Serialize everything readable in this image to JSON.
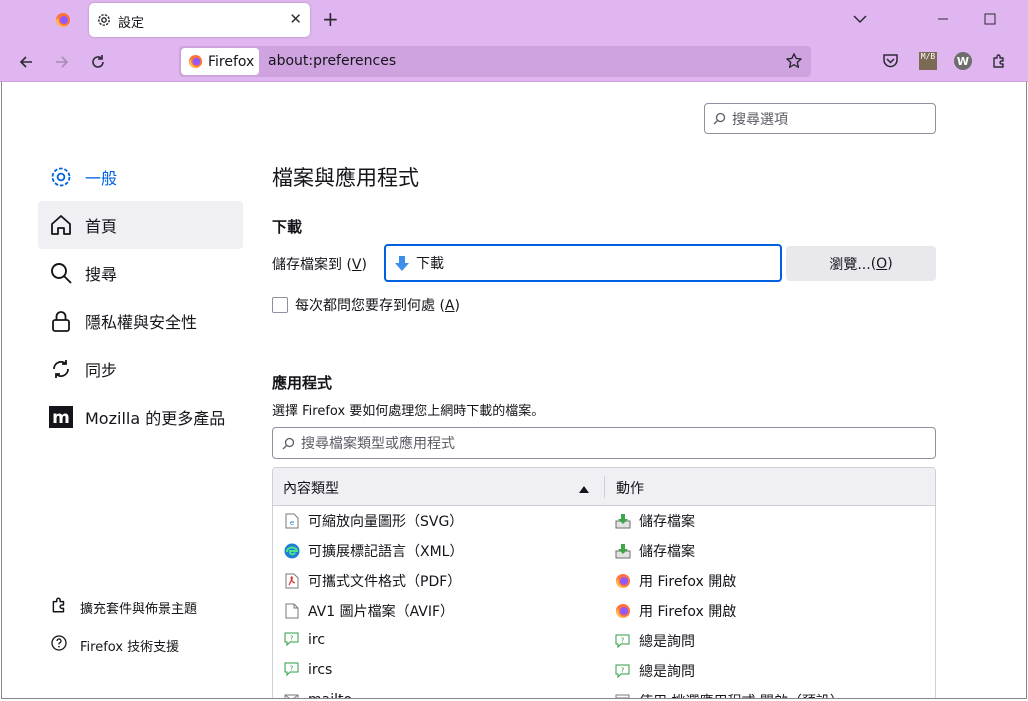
{
  "browser": {
    "tab_title": "設定",
    "identity_label": "Firefox",
    "url": "about:preferences",
    "ext_mb_text": "M/B",
    "ext_w_text": "W"
  },
  "search": {
    "placeholder": "搜尋選項"
  },
  "sidebar": {
    "items": [
      {
        "label": "一般",
        "icon": "gear-icon",
        "selected": true
      },
      {
        "label": "首頁",
        "icon": "home-icon"
      },
      {
        "label": "搜尋",
        "icon": "search-icon"
      },
      {
        "label": "隱私權與安全性",
        "icon": "lock-icon"
      },
      {
        "label": "同步",
        "icon": "sync-icon"
      },
      {
        "label": "Mozilla 的更多產品",
        "icon": "mozilla-icon"
      }
    ],
    "footer": [
      {
        "label": "擴充套件與佈景主題",
        "icon": "puzzle-icon"
      },
      {
        "label": "Firefox 技術支援",
        "icon": "help-icon"
      }
    ]
  },
  "main": {
    "section_title": "檔案與應用程式",
    "downloads": {
      "heading": "下載",
      "save_label": "儲存檔案到 ",
      "save_key": "V",
      "folder": "下載",
      "browse_label": "瀏覽... ",
      "browse_key": "O",
      "ask_label": "每次都問您要存到何處 ",
      "ask_key": "A"
    },
    "applications": {
      "heading": "應用程式",
      "description": "選擇 Firefox 要如何處理您上網時下載的檔案。",
      "search_placeholder": "搜尋檔案類型或應用程式",
      "col_type": "內容類型",
      "col_action": "動作",
      "rows": [
        {
          "type": "可縮放向量圖形（SVG）",
          "type_icon": "svg-file-icon",
          "action": "儲存檔案",
          "action_icon": "save-file-icon"
        },
        {
          "type": "可擴展標記語言（XML）",
          "type_icon": "edge-icon",
          "action": "儲存檔案",
          "action_icon": "save-file-icon"
        },
        {
          "type": "可攜式文件格式（PDF）",
          "type_icon": "pdf-icon",
          "action": "用 Firefox 開啟",
          "action_icon": "firefox-icon"
        },
        {
          "type": "AV1 圖片檔案（AVIF）",
          "type_icon": "file-icon",
          "action": "用 Firefox 開啟",
          "action_icon": "firefox-icon"
        },
        {
          "type": "irc",
          "type_icon": "chat-icon",
          "action": "總是詢問",
          "action_icon": "ask-icon"
        },
        {
          "type": "ircs",
          "type_icon": "chat-icon",
          "action": "總是詢問",
          "action_icon": "ask-icon"
        },
        {
          "type": "mailto",
          "type_icon": "mail-icon",
          "action": "使用 挑選應用程式 開啟（預設）",
          "action_icon": "app-icon"
        }
      ]
    }
  }
}
